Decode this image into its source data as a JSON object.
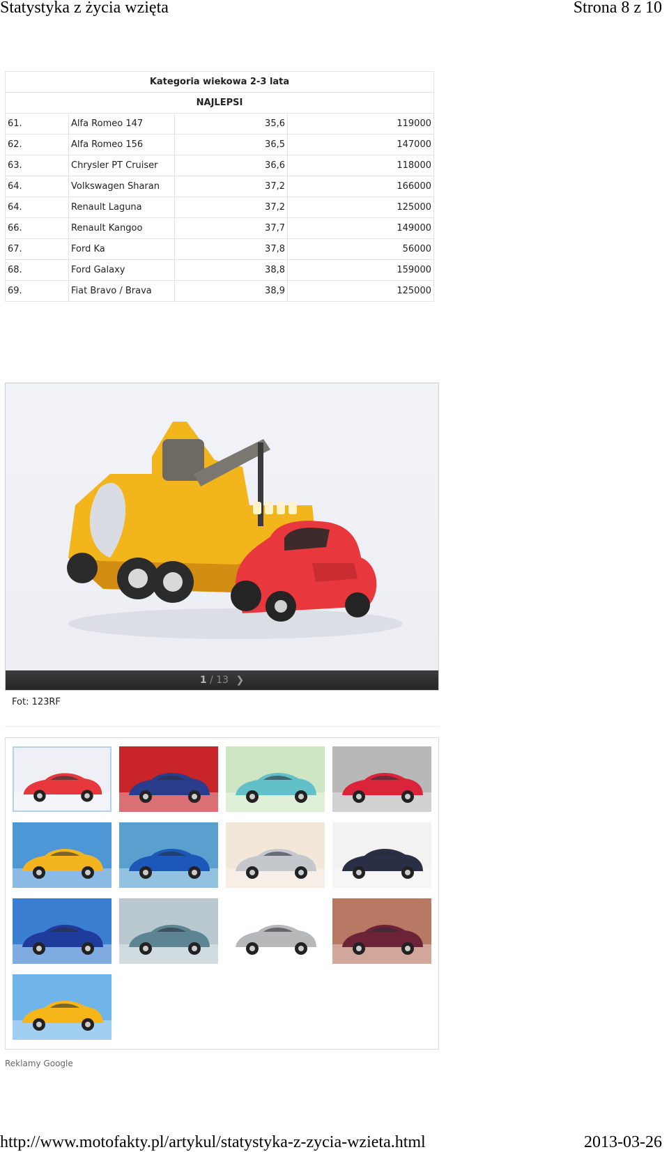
{
  "page_header": {
    "title": "Statystyka z życia wzięta",
    "page_indicator": "Strona 8 z 10"
  },
  "table": {
    "heading": "Kategoria wiekowa 2-3 lata",
    "subheading": "NAJLEPSI",
    "rows": [
      [
        "61.",
        "Alfa Romeo 147",
        "35,6",
        "119000"
      ],
      [
        "62.",
        "Alfa Romeo 156",
        "36,5",
        "147000"
      ],
      [
        "63.",
        "Chrysler PT Cruiser",
        "36,6",
        "118000"
      ],
      [
        "64.",
        "Volkswagen Sharan",
        "37,2",
        "166000"
      ],
      [
        "64.",
        "Renault Laguna",
        "37,2",
        "125000"
      ],
      [
        "66.",
        "Renault Kangoo",
        "37,7",
        "149000"
      ],
      [
        "67.",
        "Ford Ka",
        "37,8",
        "56000"
      ],
      [
        "68.",
        "Ford Galaxy",
        "38,8",
        "159000"
      ],
      [
        "69.",
        "Fiat Bravo / Brava",
        "38,9",
        "125000"
      ]
    ]
  },
  "slideshow": {
    "current": "1",
    "separator": "/ 13",
    "next_icon": "chevron-right-icon",
    "colors": {
      "truck": "#f2b51c",
      "car": "#e8383d"
    }
  },
  "photo_credit": "Fot: 123RF",
  "gallery": {
    "thumbnails": [
      {
        "subject": "tow-truck-toy",
        "bg": "#eef0f5",
        "accent": "#e8383d"
      },
      {
        "subject": "mechanic",
        "bg": "#c8242a",
        "accent": "#2a3c8c"
      },
      {
        "subject": "push-car",
        "bg": "#cfe6c4",
        "accent": "#62c1c8"
      },
      {
        "subject": "red-hatchback",
        "bg": "#b8b8b8",
        "accent": "#d9243a"
      },
      {
        "subject": "yellow-sportscar",
        "bg": "#4d97d6",
        "accent": "#f2b520"
      },
      {
        "subject": "blue-sedan",
        "bg": "#5aa0cf",
        "accent": "#1b58b8"
      },
      {
        "subject": "silver-hybrid",
        "bg": "#f3e7da",
        "accent": "#c4c8cc"
      },
      {
        "subject": "dark-cruiser",
        "bg": "#f2f2f2",
        "accent": "#2a2f45"
      },
      {
        "subject": "blue-coupe",
        "bg": "#3b7fd1",
        "accent": "#1f3c9c"
      },
      {
        "subject": "teal-cruiser",
        "bg": "#b9c9cf",
        "accent": "#5c8492"
      },
      {
        "subject": "silver-sedan",
        "bg": "#ffffff",
        "accent": "#b6b8ba"
      },
      {
        "subject": "maroon-sedan",
        "bg": "#b77964",
        "accent": "#6c2237"
      },
      {
        "subject": "yellow-coupe",
        "bg": "#6fb5ea",
        "accent": "#f6b619"
      }
    ]
  },
  "ads_label": "Reklamy Google",
  "page_footer": {
    "url": "http://www.motofakty.pl/artykul/statystyka-z-zycia-wzieta.html",
    "date": "2013-03-26"
  }
}
